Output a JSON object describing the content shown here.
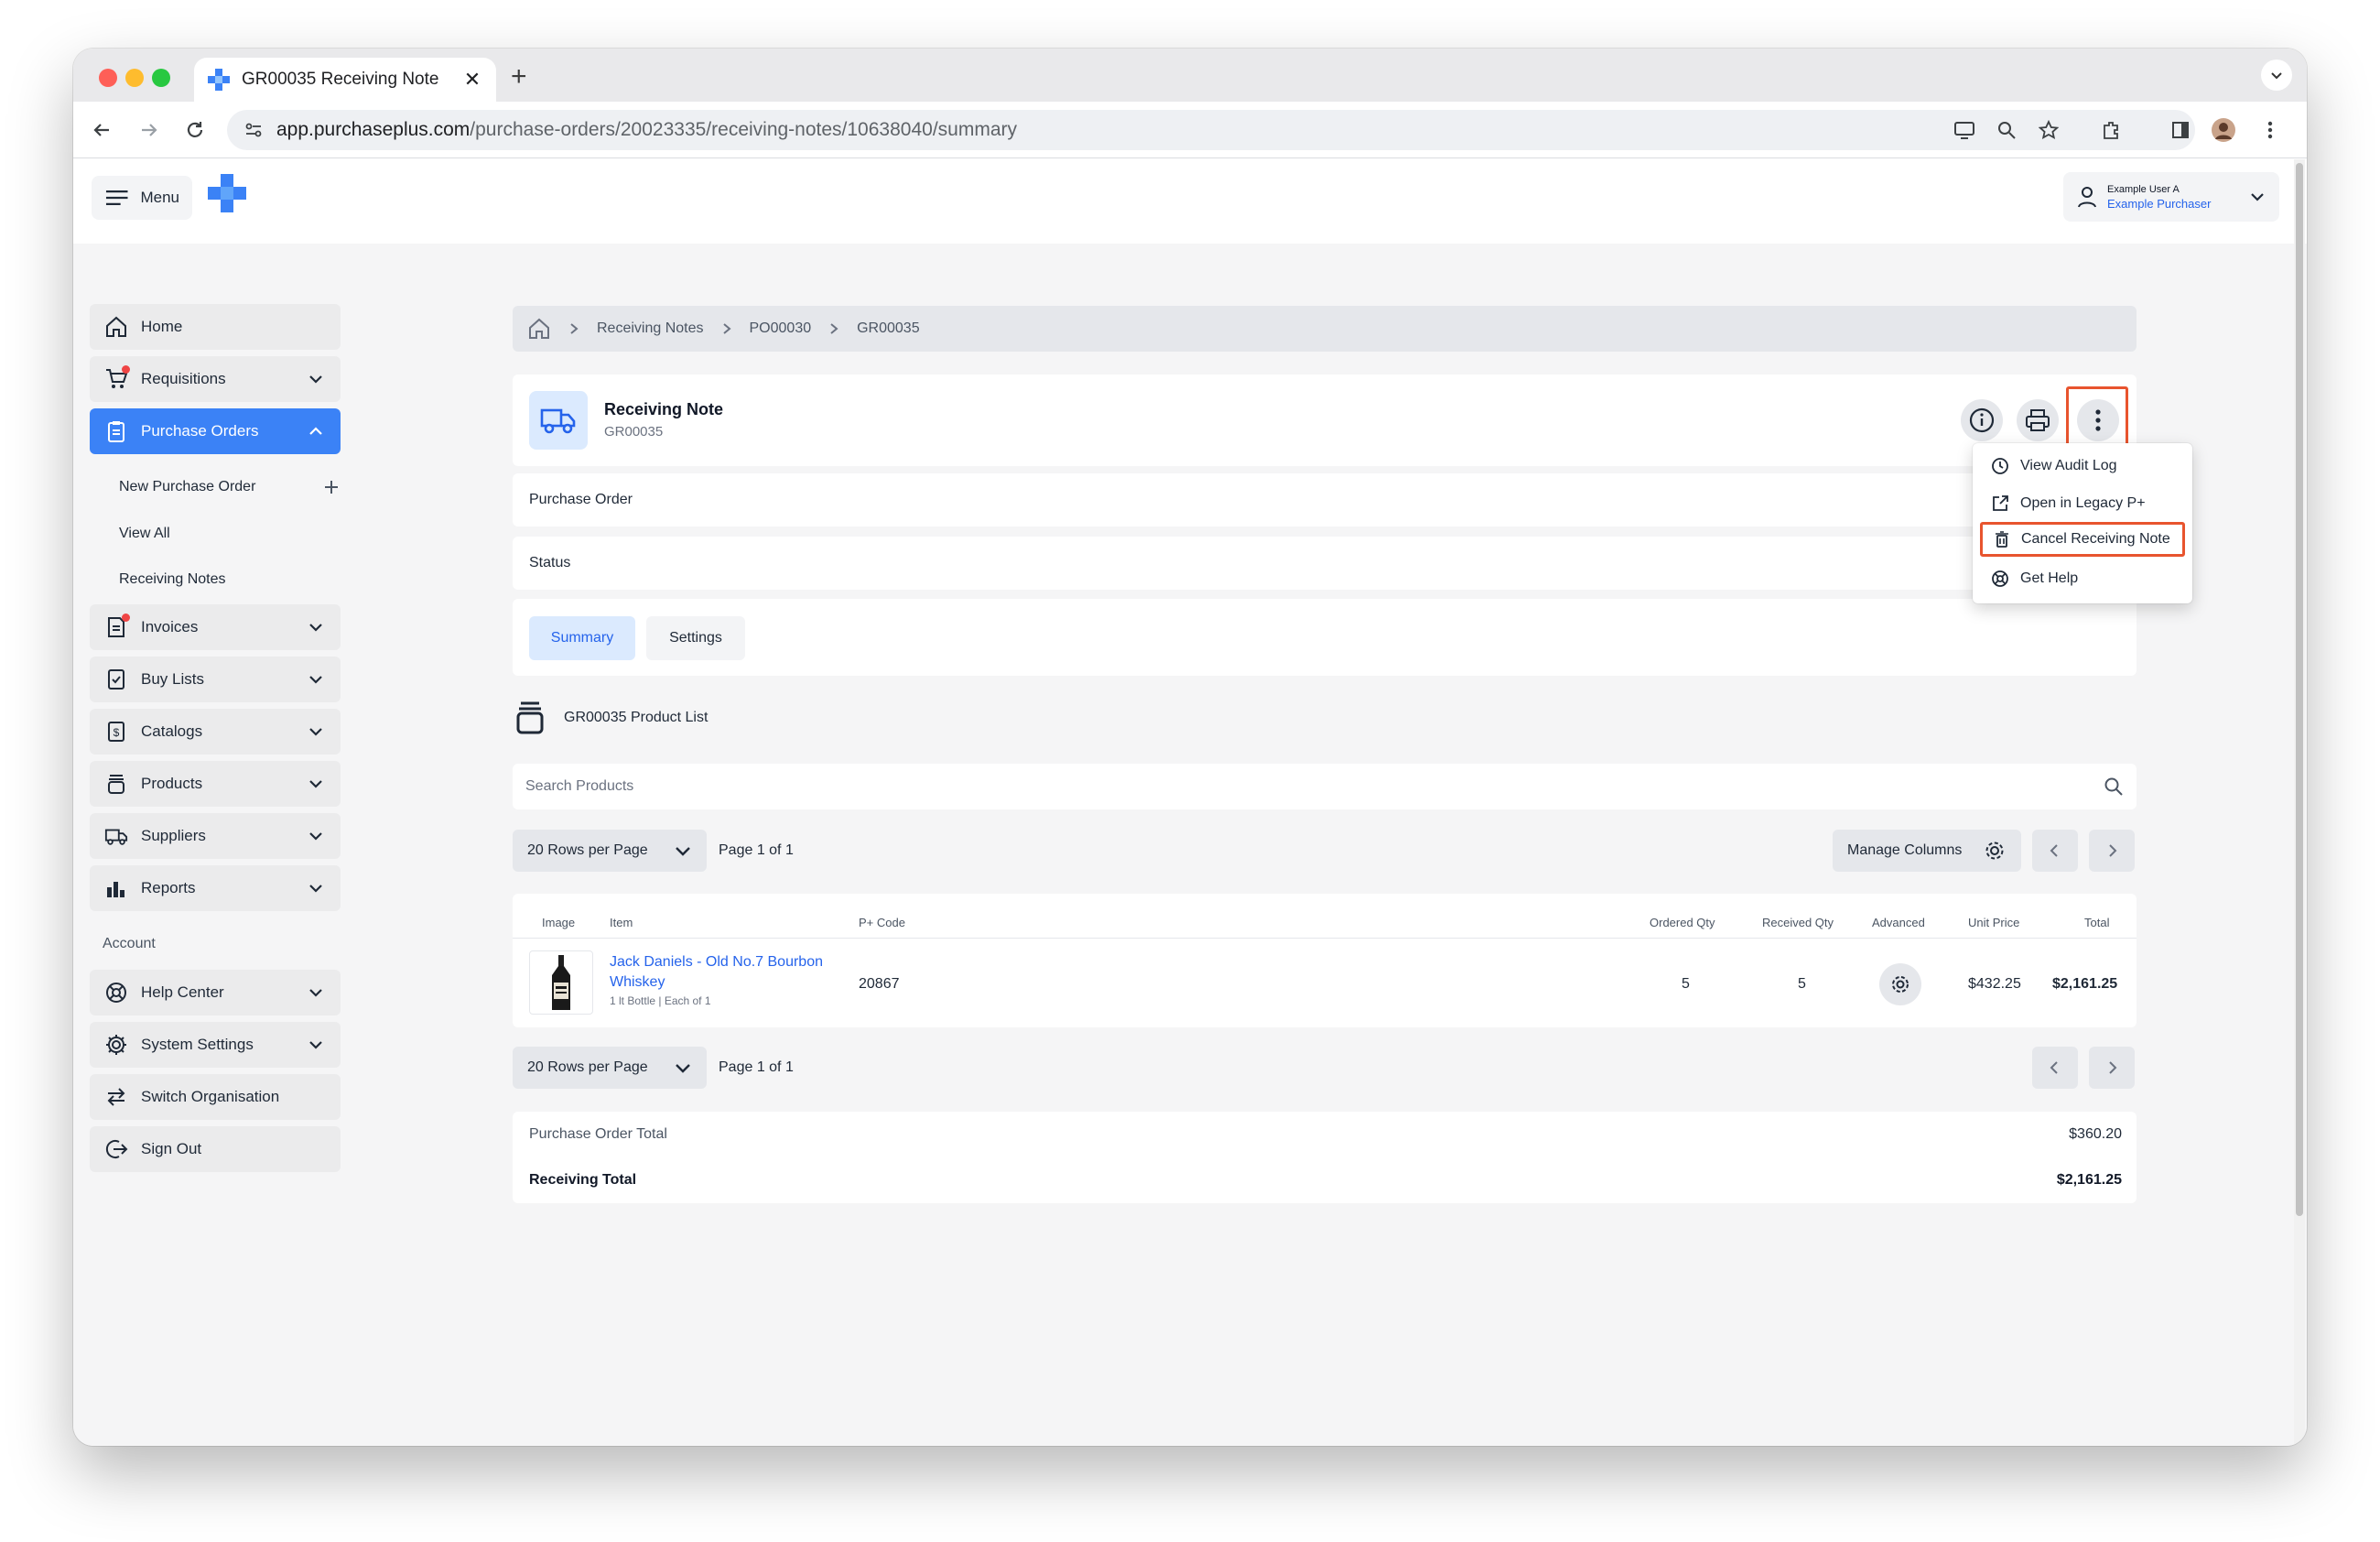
{
  "browser": {
    "tab_title": "GR00035 Receiving Note",
    "url_host": "app.purchaseplus.com",
    "url_path": "/purchase-orders/20023335/receiving-notes/10638040/summary"
  },
  "topbar": {
    "menu_label": "Menu",
    "user_name": "Example User A",
    "user_role": "Example Purchaser"
  },
  "sidebar": {
    "items": [
      {
        "label": "Home",
        "icon": "home-icon"
      },
      {
        "label": "Requisitions",
        "icon": "cart-icon"
      },
      {
        "label": "Purchase Orders",
        "icon": "clipboard-icon"
      },
      {
        "label": "Invoices",
        "icon": "invoice-icon"
      },
      {
        "label": "Buy Lists",
        "icon": "checklist-icon"
      },
      {
        "label": "Catalogs",
        "icon": "dollar-doc-icon"
      },
      {
        "label": "Products",
        "icon": "products-icon"
      },
      {
        "label": "Suppliers",
        "icon": "truck-icon"
      },
      {
        "label": "Reports",
        "icon": "bar-chart-icon"
      }
    ],
    "sub_items": [
      "New Purchase Order",
      "View All",
      "Receiving Notes"
    ],
    "account_heading": "Account",
    "account_items": [
      {
        "label": "Help Center",
        "icon": "lifebuoy-icon"
      },
      {
        "label": "System Settings",
        "icon": "gear-icon"
      },
      {
        "label": "Switch Organisation",
        "icon": "swap-icon"
      },
      {
        "label": "Sign Out",
        "icon": "sign-out-icon"
      }
    ]
  },
  "breadcrumb": [
    "Receiving Notes",
    "PO00030",
    "GR00035"
  ],
  "header": {
    "title": "Receiving Note",
    "subtitle": "GR00035"
  },
  "rows": {
    "purchase_order": "Purchase Order",
    "status": "Status"
  },
  "tabs": [
    "Summary",
    "Settings"
  ],
  "product_list_title": "GR00035 Product List",
  "search": {
    "placeholder": "Search Products"
  },
  "pagination": {
    "rows_per_page": "20 Rows per Page",
    "page_label": "Page 1 of 1",
    "manage_columns": "Manage Columns"
  },
  "table": {
    "columns": [
      "Image",
      "Item",
      "P+ Code",
      "Ordered Qty",
      "Received Qty",
      "Advanced",
      "Unit Price",
      "Total"
    ],
    "rows": [
      {
        "item": "Jack Daniels - Old No.7 Bourbon Whiskey",
        "meta": "1 lt Bottle | Each of 1",
        "code": "20867",
        "ordered_qty": "5",
        "received_qty": "5",
        "unit_price": "$432.25",
        "total": "$2,161.25"
      }
    ]
  },
  "totals": {
    "po_total_label": "Purchase Order Total",
    "po_total_value": "$360.20",
    "receiving_total_label": "Receiving Total",
    "receiving_total_value": "$2,161.25"
  },
  "dropdown": {
    "items": [
      {
        "label": "View Audit Log",
        "icon": "clock-icon"
      },
      {
        "label": "Open in Legacy P+",
        "icon": "external-link-icon"
      },
      {
        "label": "Cancel Receiving Note",
        "icon": "trash-icon"
      },
      {
        "label": "Get Help",
        "icon": "lifebuoy-icon"
      }
    ]
  },
  "colors": {
    "accent": "#3b82f6",
    "link": "#2563eb",
    "highlight": "#e8542e",
    "notification": "#ef4444"
  }
}
